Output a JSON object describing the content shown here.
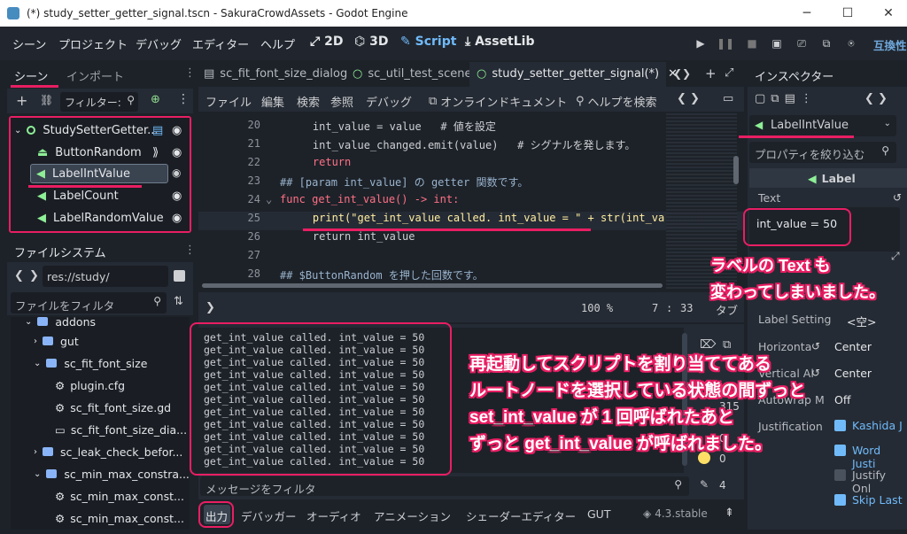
{
  "window": {
    "title": "(*) study_setter_getter_signal.tscn - SakuraCrowdAssets - Godot Engine",
    "minimize": "─",
    "maximize": "☐",
    "close": "✕"
  },
  "menu": {
    "items": [
      "シーン",
      "プロジェクト",
      "デバッグ",
      "エディター",
      "ヘルプ"
    ],
    "ws_2d": "2D",
    "ws_3d": "3D",
    "ws_script": "Script",
    "ws_assetlib": "AssetLib",
    "compat": "互換性"
  },
  "scene_dock": {
    "tabs": [
      "シーン",
      "インポート"
    ],
    "filter_placeholder": "フィルター:",
    "nodes": [
      {
        "label": "StudySetterGetter..."
      },
      {
        "label": "ButtonRandom"
      },
      {
        "label": "LabelIntValue"
      },
      {
        "label": "LabelCount"
      },
      {
        "label": "LabelRandomValue"
      }
    ]
  },
  "filesystem": {
    "title": "ファイルシステム",
    "path": "res://study/",
    "filter_placeholder": "ファイルをフィルタ",
    "items": [
      "addons",
      "gut",
      "sc_fit_font_size",
      "plugin.cfg",
      "sc_fit_font_size.gd",
      "sc_fit_font_size_dia...",
      "sc_leak_check_befor...",
      "sc_min_max_constra...",
      "sc_min_max_const...",
      "sc_min_max_const..."
    ]
  },
  "editor": {
    "tabs": [
      "sc_fit_font_size_dialog",
      "sc_util_test_scene",
      "study_setter_getter_signal(*)"
    ],
    "menu": [
      "ファイル",
      "編集",
      "検索",
      "参照",
      "デバッグ"
    ],
    "online_docs": "オンラインドキュメント",
    "search_help": "ヘルプを検索",
    "code": [
      {
        "n": "20",
        "t": "    int_value = value   # 値を設定"
      },
      {
        "n": "21",
        "t": "    int_value_changed.emit(value)   # シグナルを発します。"
      },
      {
        "n": "22",
        "t": "    return"
      },
      {
        "n": "23",
        "t": "## [param int_value] の getter 関数です。"
      },
      {
        "n": "24",
        "t": "func get_int_value() -> int:"
      },
      {
        "n": "25",
        "t": "    print(\"get_int_value called. int_value = \" + str(int_va"
      },
      {
        "n": "26",
        "t": "    return int_value"
      },
      {
        "n": "27",
        "t": ""
      },
      {
        "n": "28",
        "t": "## $ButtonRandom を押した回数です。"
      }
    ],
    "zoom": "100 %",
    "line": "7",
    "col": "33",
    "indent": "タブ"
  },
  "output": {
    "lines": [
      "get_int_value called. int_value = 50",
      "get_int_value called. int_value = 50",
      "get_int_value called. int_value = 50",
      "get_int_value called. int_value = 50",
      "get_int_value called. int_value = 50",
      "get_int_value called. int_value = 50",
      "get_int_value called. int_value = 50",
      "get_int_value called. int_value = 50",
      "get_int_value called. int_value = 50",
      "get_int_value called. int_value = 50",
      "get_int_value called. int_value = 50"
    ],
    "filter_placeholder": "メッセージをフィルタ",
    "count_msgs": "315",
    "count_errors": "0",
    "count_warn": "0",
    "count_info": "4"
  },
  "bottom_tabs": [
    "出力",
    "デバッガー",
    "オーディオ",
    "アニメーション",
    "シェーダーエディター",
    "GUT"
  ],
  "version": "4.3.stable",
  "inspector": {
    "tab": "インスペクター",
    "node": "LabelIntValue",
    "filter_placeholder": "プロパティを絞り込む",
    "class": "Label",
    "text_label": "Text",
    "text_value": "int_value = 50",
    "label_settings_label": "Label Setting",
    "label_settings_value": "<空>",
    "halign_label": "Horizonta",
    "halign_value": "Center",
    "valign_label": "Vertical Al",
    "valign_value": "Center",
    "autowrap_label": "Autowrap M",
    "autowrap_value": "Off",
    "justification_label": "Justification",
    "flags": [
      {
        "label": "Kashida J",
        "checked": true
      },
      {
        "label": "Word Justi",
        "checked": true
      },
      {
        "label": "Justify Onl",
        "checked": false
      },
      {
        "label": "Skip Last",
        "checked": true
      }
    ]
  },
  "annotations": {
    "label_changed_1": "ラベルの Text も",
    "label_changed_2": "変わってしまいました。",
    "main_1": "再起動してスクリプトを割り当ててある",
    "main_2": "ルートノードを選択している状態の間ずっと",
    "main_3": "set_int_value が 1 回呼ばれたあと",
    "main_4": "ずっと get_int_value が呼ばれました。"
  },
  "colors": {
    "accent": "#e91e63",
    "godot_blue": "#478cbf",
    "panel": "#252b34",
    "bg": "#1d2229",
    "keyword": "#ff7085",
    "string": "#ffeda1",
    "comment": "#8d939b",
    "label_green": "#8eef97"
  }
}
